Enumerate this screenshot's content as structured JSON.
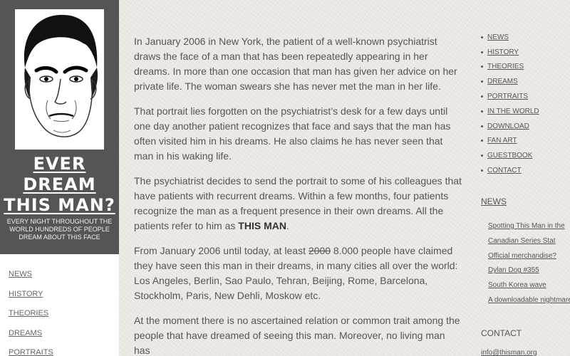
{
  "site": {
    "title_lines": [
      "EVER",
      "DREAM",
      "THIS MAN?"
    ],
    "tagline": "EVERY NIGHT THROUGHOUT THE WORLD HUNDREDS OF PEOPLE DREAM ABOUT THIS FACE"
  },
  "left_nav": [
    "NEWS",
    "HISTORY",
    "THEORIES",
    "DREAMS",
    "PORTRAITS"
  ],
  "article": {
    "p1": "In January 2006 in New York, the patient of a well-known psychiatrist draws the face of a man that has been repeatedly appearing in her dreams. In more than one occasion that man has given her advice on her private life. The woman swears she has never met the man in her life.",
    "p2": "That portrait lies forgotten on the psychiatrist’s desk for a few days until one day another patient recognizes that face and says that the man has often visited him in his dreams. He also claims he has never seen that man in his waking life.",
    "p3_pre": "The psychiatrist decides to send the portrait to some of his colleagues that have patients with recurrent dreams. Within a few months, four patients recognize the man as a frequent presence in their own dreams. All the patients refer to him as ",
    "p3_bold": "THIS MAN",
    "p3_post": ".",
    "p4_pre": "From January 2006 until today, at least ",
    "p4_strike": "2000",
    "p4_post": " 8.000 people have claimed they have seen this man in their dreams, in many cities all over the world: Los Angeles, Berlin, Sao Paulo, Tehran, Beijing, Rome, Barcelona, Stockholm, Paris, New Dehli, Moskow etc.",
    "p5": "At the moment there is no ascertained relation or common trait among the people that have dreamed of seeing this man. Moreover, no living man has"
  },
  "right_nav": [
    "NEWS",
    "HISTORY",
    "THEORIES",
    "DREAMS",
    "PORTRAITS",
    "IN THE WORLD",
    "DOWNLOAD",
    "FAN ART",
    "GUESTBOOK",
    "CONTACT"
  ],
  "news": {
    "heading": "NEWS",
    "items": [
      "Spotting This Man in the",
      "Canadian Series Stat",
      "Official merchandise?",
      "Dylan Dog #355",
      "South Korea wave",
      "A downloadable nightmare"
    ]
  },
  "contact": {
    "heading": "CONTACT",
    "email": "info@thisman.org"
  }
}
